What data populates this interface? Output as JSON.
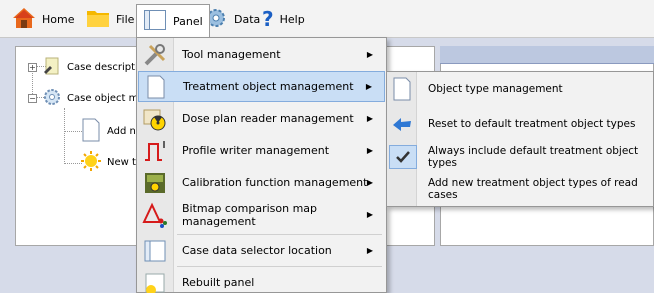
{
  "menubar": {
    "items": [
      {
        "label": "Home",
        "icon": "home-icon"
      },
      {
        "label": "File",
        "icon": "folder-icon"
      },
      {
        "label": "Panel",
        "icon": "panel-icon"
      },
      {
        "label": "Data",
        "icon": "gear-icon"
      },
      {
        "label": "Help",
        "icon": "question-icon"
      }
    ]
  },
  "tree": {
    "nodes": [
      {
        "label": "Case descripti"
      },
      {
        "label": "Case object ma"
      },
      {
        "label": "Add new"
      },
      {
        "label": "New tre"
      }
    ]
  },
  "panel_menu": {
    "items": [
      {
        "label": "Tool management",
        "icon": "tools-icon"
      },
      {
        "label": "Treatment object management",
        "icon": "document-icon"
      },
      {
        "label": "Dose plan reader management",
        "icon": "radiation-icon"
      },
      {
        "label": "Profile writer management",
        "icon": "pulse-icon"
      },
      {
        "label": "Calibration function management",
        "icon": "calibration-icon"
      },
      {
        "label": "Bitmap comparison map management",
        "icon": "delta-icon"
      },
      {
        "label": "Case data selector location",
        "icon": "panel-icon"
      },
      {
        "label": "Rebuilt panel",
        "icon": "sun-icon"
      }
    ]
  },
  "submenu": {
    "items": [
      {
        "label": "Object type management",
        "icon": "document-icon"
      },
      {
        "label": "Reset to default treatment object types",
        "icon": "back-arrow-icon"
      },
      {
        "label": "Always include default treatment object types",
        "icon": "checkmark-icon",
        "checked": true
      },
      {
        "label": "Add new treatment object types of read cases"
      }
    ]
  },
  "colors": {
    "highlight": "#c9def5",
    "highlight_border": "#84acdd",
    "menu_bg": "#f2f2f2"
  }
}
